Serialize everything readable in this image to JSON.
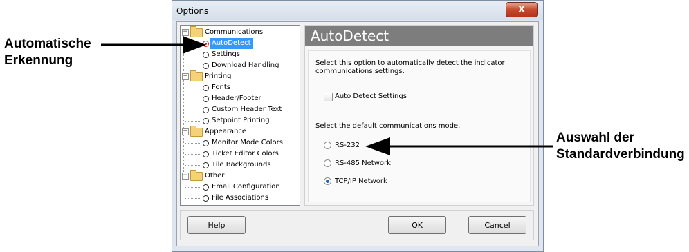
{
  "window": {
    "title": "Options",
    "close_label": "x"
  },
  "callouts": {
    "left_line1": "Automatische",
    "left_line2": "Erkennung",
    "right_line1": "Auswahl der",
    "right_line2": "Standardverbindung"
  },
  "tree": {
    "groups": [
      {
        "label": "Communications",
        "items": [
          "AutoDetect",
          "Settings",
          "Download Handling"
        ]
      },
      {
        "label": "Printing",
        "items": [
          "Fonts",
          "Header/Footer",
          "Custom Header Text",
          "Setpoint Printing"
        ]
      },
      {
        "label": "Appearance",
        "items": [
          "Monitor Mode Colors",
          "Ticket Editor Colors",
          "Tile Backgrounds"
        ]
      },
      {
        "label": "Other",
        "items": [
          "Email Configuration",
          "File Associations"
        ]
      }
    ],
    "toggle_symbol": "−"
  },
  "panel": {
    "header": "AutoDetect",
    "description_line1": "Select this option to automatically detect the indicator",
    "description_line2": "communications settings.",
    "checkbox_label": "Auto Detect Settings",
    "checkbox_checked": false,
    "mode_prompt": "Select the default communications mode.",
    "modes": [
      {
        "label": "RS-232",
        "selected": false
      },
      {
        "label": "RS-485 Network",
        "selected": false
      },
      {
        "label": "TCP/IP Network",
        "selected": true
      }
    ]
  },
  "buttons": {
    "help": "Help",
    "ok": "OK",
    "cancel": "Cancel"
  },
  "colors": {
    "selection": "#3399ff",
    "panel_header": "#7d7d7d",
    "close_button": "#c44a2e"
  }
}
